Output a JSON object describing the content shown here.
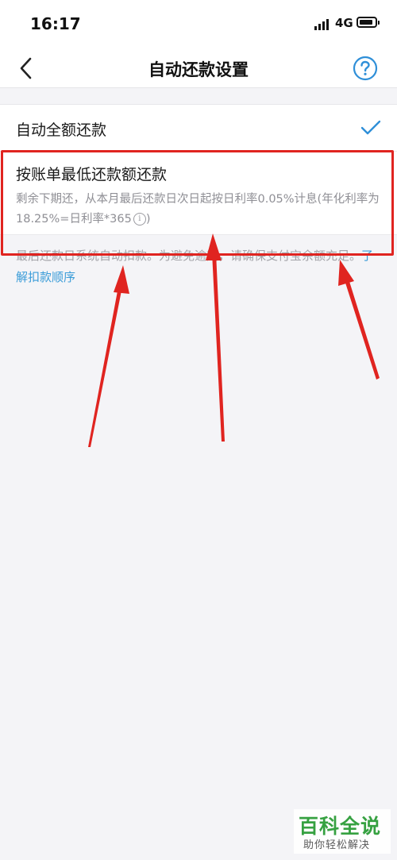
{
  "status_bar": {
    "time": "16:17",
    "network": "4G"
  },
  "nav": {
    "title": "自动还款设置"
  },
  "options": {
    "full": {
      "label": "自动全额还款",
      "selected": true
    },
    "minimum": {
      "label": "按账单最低还款额还款",
      "description": "剩余下期还，从本月最后还款日次日起按日利率0.05%计息(年化利率为18.25%=日利率*365",
      "description_close": ")"
    }
  },
  "footnote": {
    "text": "最后还款日系统自动扣款。为避免逾期，请确保支付宝余额充足。",
    "link": "了解扣款顺序"
  },
  "colors": {
    "annotation_red": "#e02420",
    "link_blue": "#3a9cd8",
    "accent_blue": "#2f8fd8"
  },
  "icons": {
    "back": "chevron-left-icon",
    "help": "question-circle-icon",
    "check": "check-icon",
    "info": "info-circle-icon"
  },
  "watermark": {
    "title": "百科全说",
    "subtitle": "助你轻松解决"
  }
}
